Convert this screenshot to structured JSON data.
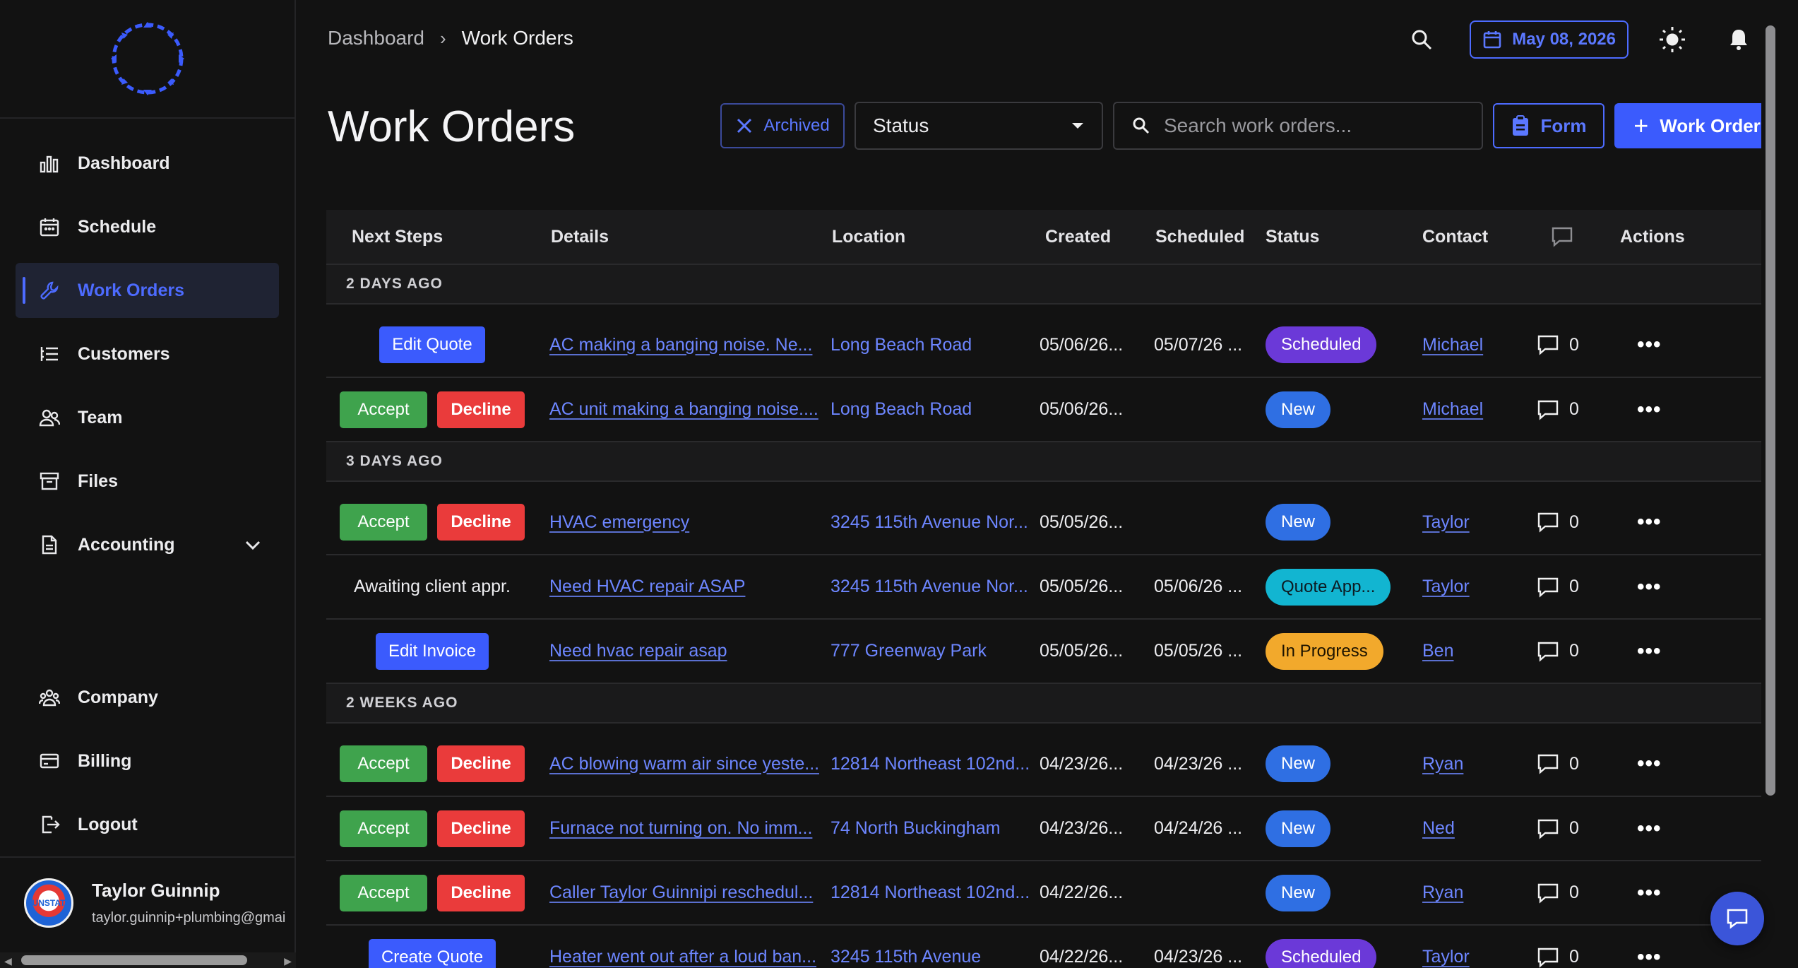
{
  "colors": {
    "accent": "#3b5bfd",
    "link": "#6d86ff",
    "accept": "#3fa34d",
    "decline": "#ea3b3b",
    "scheduled": "#6b39d8",
    "new": "#2f6fe3",
    "quote": "#12b5d1",
    "in_progress": "#f2a92c"
  },
  "sidebar": {
    "items": [
      {
        "label": "Dashboard",
        "icon": "bar-chart-icon"
      },
      {
        "label": "Schedule",
        "icon": "calendar-icon"
      },
      {
        "label": "Work Orders",
        "icon": "wrench-icon"
      },
      {
        "label": "Customers",
        "icon": "list-icon"
      },
      {
        "label": "Team",
        "icon": "users-icon"
      },
      {
        "label": "Files",
        "icon": "archive-icon"
      },
      {
        "label": "Accounting",
        "icon": "document-icon"
      }
    ],
    "bottom_items": [
      {
        "label": "Company",
        "icon": "company-icon"
      },
      {
        "label": "Billing",
        "icon": "card-icon"
      },
      {
        "label": "Logout",
        "icon": "logout-icon"
      }
    ],
    "user": {
      "name": "Taylor Guinnip",
      "email": "taylor.guinnip+plumbing@gmai",
      "avatar_text": "SUNSTATE"
    }
  },
  "header": {
    "breadcrumb": {
      "home": "Dashboard",
      "sep": "›",
      "current": "Work Orders"
    },
    "date": "May 08, 2026"
  },
  "page": {
    "title": "Work Orders",
    "archived_label": "Archived",
    "status_label": "Status",
    "search_placeholder": "Search work orders...",
    "form_label": "Form",
    "new_label": "Work Order"
  },
  "table": {
    "columns": [
      "Next Steps",
      "Details",
      "Location",
      "Created",
      "Scheduled",
      "Status",
      "Contact",
      "",
      "Actions"
    ],
    "groups": [
      {
        "label": "2 DAYS AGO",
        "rows": [
          {
            "buttons": [
              "Edit Quote"
            ],
            "details": "AC making a banging noise. Ne...",
            "location": "Long Beach Road",
            "created": "05/06/26...",
            "scheduled": "05/07/26 ...",
            "status": "Scheduled",
            "contact": "Michael",
            "comments": "0"
          },
          {
            "buttons": [
              "Accept",
              "Decline"
            ],
            "details": "AC unit making a banging noise....",
            "location": "Long Beach Road",
            "created": "05/06/26...",
            "scheduled": "",
            "status": "New",
            "contact": "Michael",
            "comments": "0"
          }
        ]
      },
      {
        "label": "3 DAYS AGO",
        "rows": [
          {
            "buttons": [
              "Accept",
              "Decline"
            ],
            "details": "HVAC emergency",
            "location": "3245 115th Avenue Nor...",
            "created": "05/05/26...",
            "scheduled": "",
            "status": "New",
            "contact": "Taylor",
            "comments": "0"
          },
          {
            "text": "Awaiting client appr.",
            "details": "Need HVAC repair ASAP",
            "location": "3245 115th Avenue Nor...",
            "created": "05/05/26...",
            "scheduled": "05/06/26 ...",
            "status": "Quote App...",
            "contact": "Taylor",
            "comments": "0"
          },
          {
            "buttons": [
              "Edit Invoice"
            ],
            "details": "Need hvac repair asap",
            "location": "777 Greenway Park",
            "created": "05/05/26...",
            "scheduled": "05/05/26 ...",
            "status": "In Progress",
            "contact": "Ben",
            "comments": "0"
          }
        ]
      },
      {
        "label": "2 WEEKS AGO",
        "rows": [
          {
            "buttons": [
              "Accept",
              "Decline"
            ],
            "details": "AC blowing warm air since yeste...",
            "location": "12814 Northeast 102nd...",
            "created": "04/23/26...",
            "scheduled": "04/23/26 ...",
            "status": "New",
            "contact": "Ryan",
            "comments": "0"
          },
          {
            "buttons": [
              "Accept",
              "Decline"
            ],
            "details": "Furnace not turning on. No imm...",
            "location": "74 North Buckingham",
            "created": "04/23/26...",
            "scheduled": "04/24/26 ...",
            "status": "New",
            "contact": "Ned",
            "comments": "0"
          },
          {
            "buttons": [
              "Accept",
              "Decline"
            ],
            "details": "Caller Taylor Guinnipi reschedul...",
            "location": "12814 Northeast 102nd...",
            "created": "04/22/26...",
            "scheduled": "",
            "status": "New",
            "contact": "Ryan",
            "comments": "0"
          },
          {
            "buttons": [
              "Create Quote"
            ],
            "details": "Heater went out after a loud ban...",
            "location": "3245 115th Avenue",
            "created": "04/22/26...",
            "scheduled": "04/23/26 ...",
            "status": "Scheduled",
            "contact": "Taylor",
            "comments": "0"
          }
        ]
      }
    ]
  }
}
